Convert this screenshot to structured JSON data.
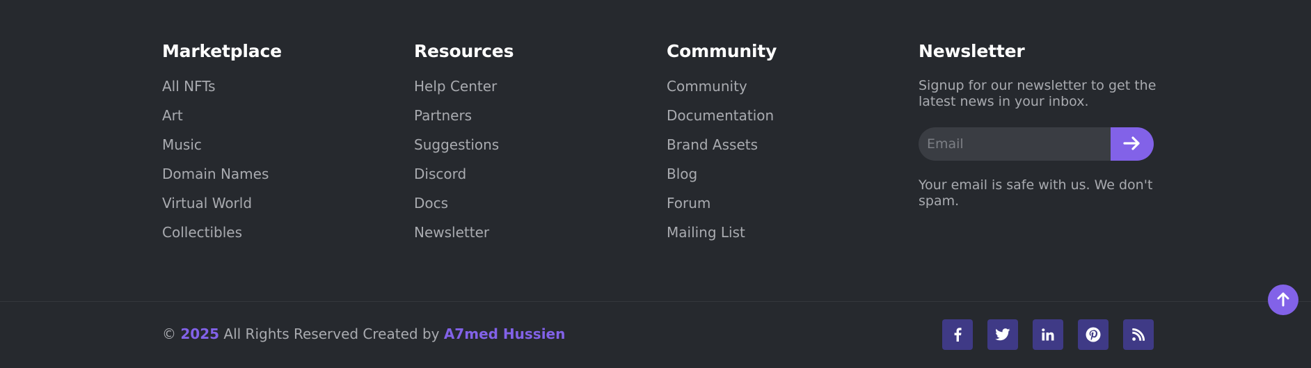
{
  "columns": [
    {
      "title": "Marketplace",
      "links": [
        "All NFTs",
        "Art",
        "Music",
        "Domain Names",
        "Virtual World",
        "Collectibles"
      ]
    },
    {
      "title": "Resources",
      "links": [
        "Help Center",
        "Partners",
        "Suggestions",
        "Discord",
        "Docs",
        "Newsletter"
      ]
    },
    {
      "title": "Community",
      "links": [
        "Community",
        "Documentation",
        "Brand Assets",
        "Blog",
        "Forum",
        "Mailing List"
      ]
    }
  ],
  "newsletter": {
    "title": "Newsletter",
    "description": "Signup for our newsletter to get the latest news in your inbox.",
    "email_placeholder": "Email",
    "email_value": "",
    "submit_icon": "arrow-right-icon",
    "note": "Your email is safe with us. We don't spam."
  },
  "copyright": {
    "symbol": "©",
    "year": "2025",
    "text": "All Rights Reserved Created by",
    "author": "A7med Hussien"
  },
  "social": [
    {
      "name": "facebook",
      "icon": "facebook-icon"
    },
    {
      "name": "twitter",
      "icon": "twitter-icon"
    },
    {
      "name": "linkedin",
      "icon": "linkedin-icon"
    },
    {
      "name": "pinterest",
      "icon": "pinterest-icon"
    },
    {
      "name": "rss",
      "icon": "rss-icon"
    }
  ],
  "scroll_top": {
    "icon": "arrow-up-icon"
  },
  "colors": {
    "background": "#26292e",
    "accent": "#8262e8",
    "social_bg": "#3f3a86",
    "heading": "#ffffff",
    "text": "#a9abb0"
  }
}
